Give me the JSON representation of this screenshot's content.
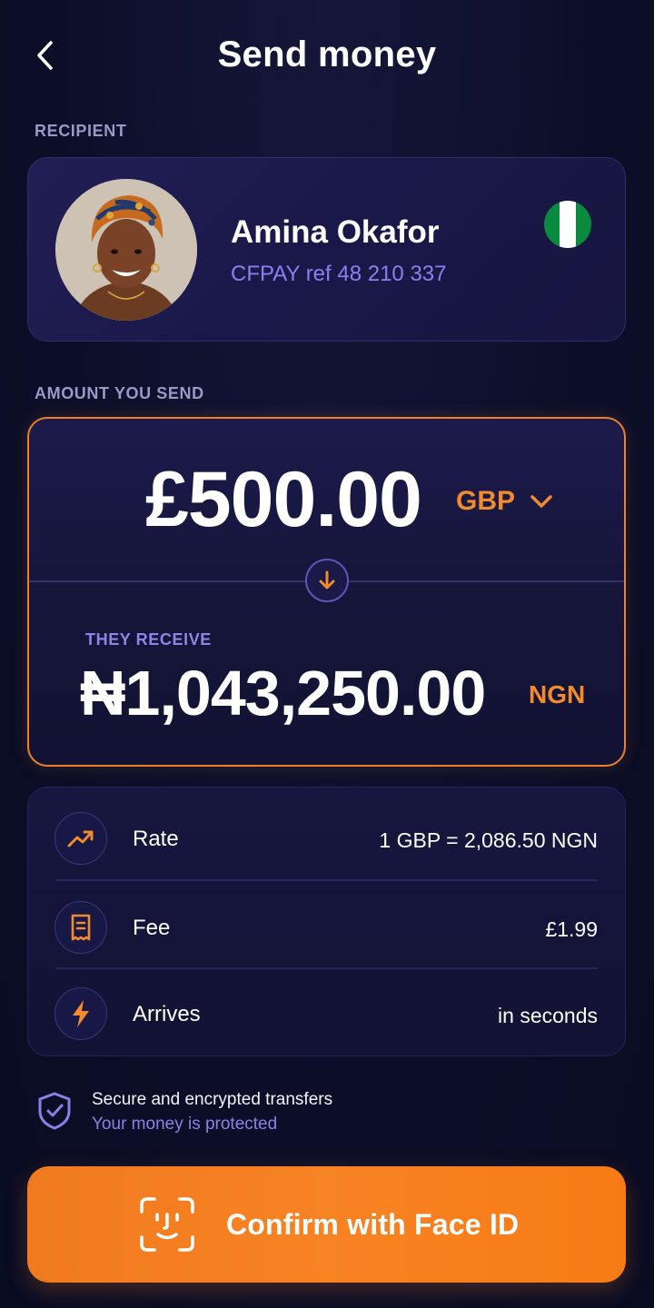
{
  "header": {
    "title": "Send money",
    "back_icon": "chevron-left-icon"
  },
  "recipient_section": {
    "label": "RECIPIENT",
    "name": "Amina Okafor",
    "reference": "CFPAY ref 48 210 337",
    "flag_icon": "nigeria-flag-icon",
    "flag_colors": [
      "#0a8a3f",
      "#ffffff",
      "#0a8a3f"
    ]
  },
  "amount_section": {
    "label": "AMOUNT YOU SEND",
    "send_amount": "£500.00",
    "send_currency": "GBP",
    "receive_label": "THEY RECEIVE",
    "receive_amount": "₦1,043,250.00",
    "receive_currency": "NGN"
  },
  "details": [
    {
      "icon": "trending-up-icon",
      "label": "Rate",
      "value": "1 GBP = 2,086.50 NGN"
    },
    {
      "icon": "receipt-icon",
      "label": "Fee",
      "value": "£1.99"
    },
    {
      "icon": "lightning-icon",
      "label": "Arrives",
      "value": "in seconds"
    }
  ],
  "security": {
    "icon": "shield-check-icon",
    "title": "Secure and encrypted transfers",
    "subtitle": "Your money is protected"
  },
  "confirm": {
    "icon": "face-id-icon",
    "label": "Confirm with Face ID"
  },
  "colors": {
    "accent": "#f28a2e",
    "secondary": "#8c7ff0",
    "background": "#0d0f2b"
  }
}
